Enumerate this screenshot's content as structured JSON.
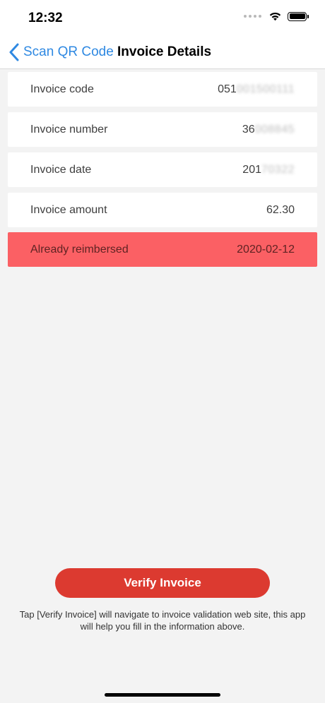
{
  "status_bar": {
    "time": "12:32",
    "icons": [
      "signal-dots-icon",
      "wifi-icon",
      "battery-icon"
    ]
  },
  "nav": {
    "back_label": "Scan QR Code",
    "title": "Invoice Details",
    "accent_color": "#2f89e2"
  },
  "rows": [
    {
      "label": "Invoice code",
      "value_visible": "051",
      "value_blurred": "001500111"
    },
    {
      "label": "Invoice number",
      "value_visible": "36",
      "value_blurred": "008845"
    },
    {
      "label": "Invoice date",
      "value_visible": "201",
      "value_blurred": "70322"
    },
    {
      "label": "Invoice amount",
      "value_visible": "62.30",
      "value_blurred": ""
    },
    {
      "label": "Already reimbersed",
      "value_visible": "2020-02-12",
      "value_blurred": "",
      "status_color": "#fb6064"
    }
  ],
  "verify": {
    "button_label": "Verify Invoice",
    "button_color": "#dc3a30",
    "hint": "Tap [Verify Invoice] will navigate to invoice validation web site, this app will help you fill in the information above."
  }
}
